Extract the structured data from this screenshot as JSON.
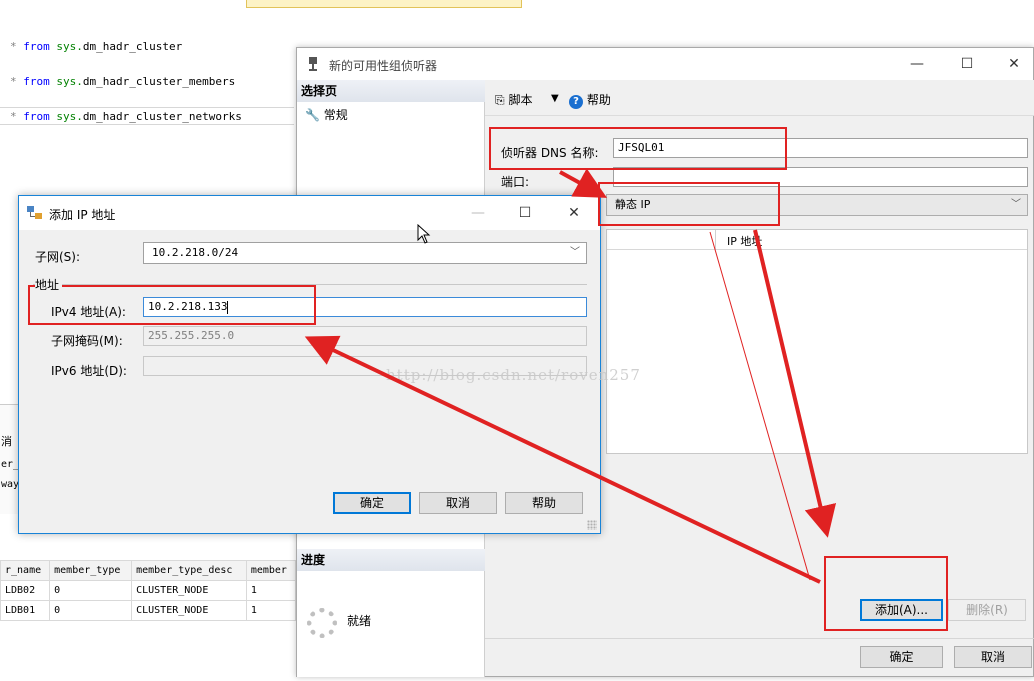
{
  "editor": {
    "lines": [
      {
        "prefix": "* ",
        "keyword": "from",
        "schema": "sys.",
        "object": "dm_hadr_cluster"
      },
      {
        "prefix": "* ",
        "keyword": "from",
        "schema": "sys.",
        "object": "dm_hadr_cluster_members"
      },
      {
        "prefix": "* ",
        "keyword": "from",
        "schema": "sys.",
        "object": "dm_hadr_cluster_networks"
      }
    ],
    "msg_tab": "消",
    "msg_frag1": "er_",
    "msg_frag2": "way"
  },
  "results": {
    "columns": [
      "r_name",
      "member_type",
      "member_type_desc",
      "member"
    ],
    "rows": [
      [
        "LDB02",
        "0",
        "CLUSTER_NODE",
        "1"
      ],
      [
        "LDB01",
        "0",
        "CLUSTER_NODE",
        "1"
      ]
    ]
  },
  "main_dialog": {
    "title": "新的可用性组侦听器",
    "select_page": "选择页",
    "general": "常规",
    "progress_header": "进度",
    "progress_status": "就绪",
    "toolbar": {
      "script": "脚本",
      "help": "帮助"
    },
    "dns_label": "侦听器 DNS 名称:",
    "dns_value": "JFSQL01",
    "port_label": "端口:",
    "port_value": "",
    "network_mode": "静态 IP",
    "grid_header": "IP 地址",
    "add_button": "添加(A)...",
    "remove_button": "删除(R)",
    "ok_button": "确定",
    "cancel_button": "取消"
  },
  "ip_dialog": {
    "title": "添加 IP 地址",
    "subnet_label": "子网(S):",
    "subnet_value": "10.2.218.0/24",
    "address_group": "地址",
    "ipv4_label": "IPv4 地址(A):",
    "ipv4_value": "10.2.218.133",
    "mask_label": "子网掩码(M):",
    "mask_value": "255.255.255.0",
    "ipv6_label": "IPv6 地址(D):",
    "ipv6_value": "",
    "ok_button": "确定",
    "cancel_button": "取消",
    "help_button": "帮助"
  },
  "watermark": "http://blog.csdn.net/roven257",
  "colors": {
    "annotation": "#e02222",
    "accent": "#0078d7"
  }
}
